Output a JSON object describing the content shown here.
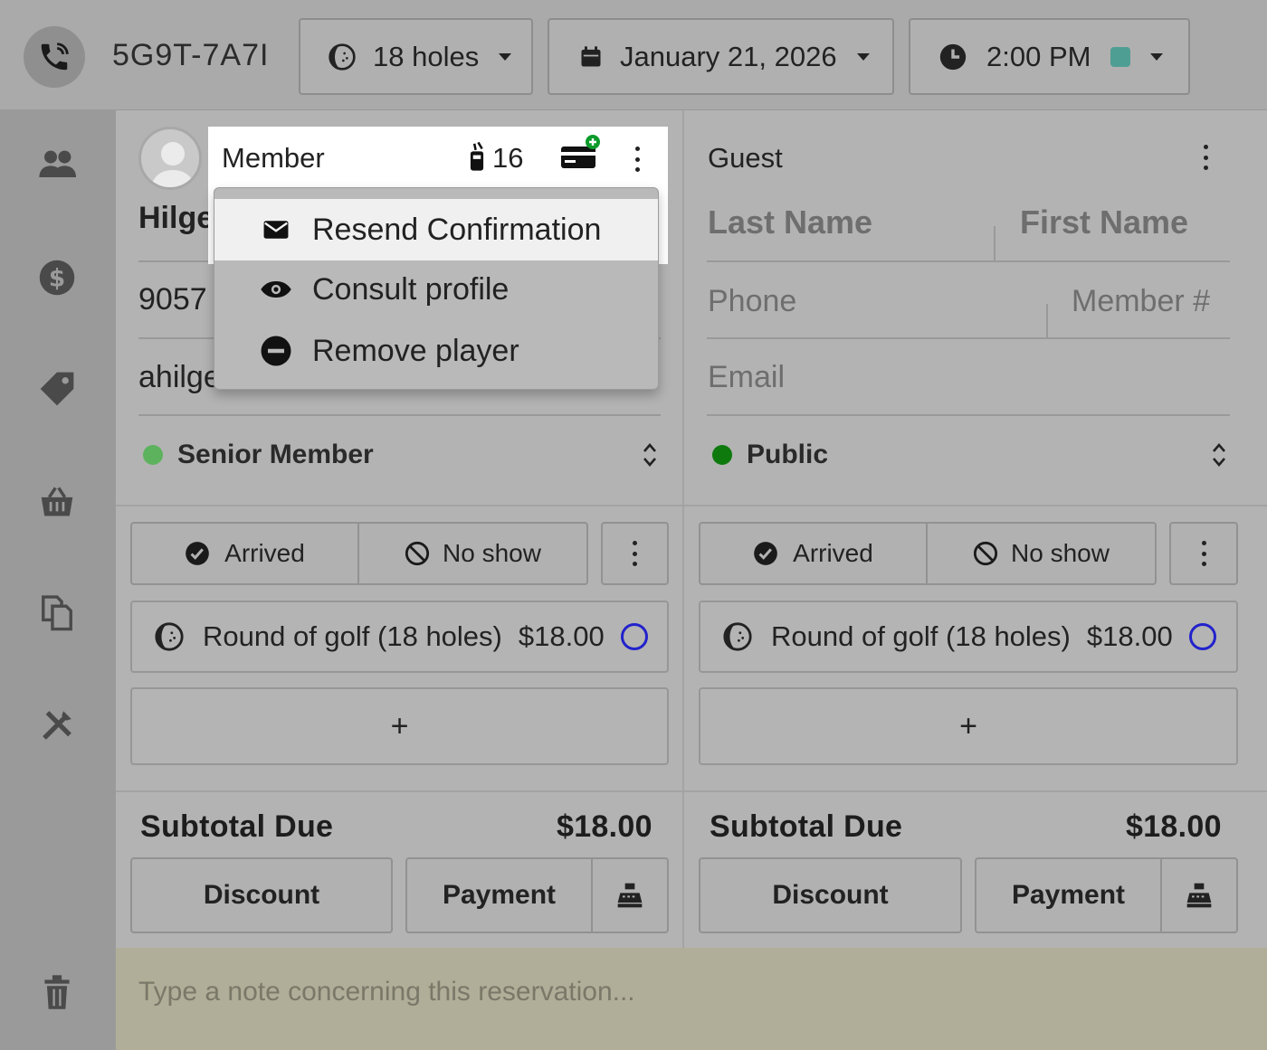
{
  "topbar": {
    "reservation_code": "5G9T-7A7I",
    "holes": "18 holes",
    "date": "January 21, 2026",
    "time": "2:00 PM",
    "time_color": "#4f9e93"
  },
  "sidebar": {
    "icons": [
      "users-icon",
      "dollar-icon",
      "tag-icon",
      "basket-icon",
      "documents-icon",
      "golf-tools-icon",
      "trash-icon"
    ]
  },
  "player1": {
    "type": "Member",
    "bag_count": "16",
    "name_partial": "Hilge",
    "phone_partial": "9057",
    "email_partial": "ahilge",
    "category": "Senior Member",
    "category_color": "#5db35d",
    "arrived": "Arrived",
    "no_show": "No show",
    "service_label": "Round of golf (18 holes)",
    "service_price": "$18.00",
    "add": "+",
    "subtotal_label": "Subtotal Due",
    "subtotal_value": "$18.00",
    "discount": "Discount",
    "payment": "Payment"
  },
  "player2": {
    "type": "Guest",
    "last_name_placeholder": "Last Name",
    "first_name_placeholder": "First Name",
    "phone_placeholder": "Phone",
    "member_placeholder": "Member #",
    "email_placeholder": "Email",
    "category": "Public",
    "category_color": "#0e7a0e",
    "arrived": "Arrived",
    "no_show": "No show",
    "service_label": "Round of golf (18 holes)",
    "service_price": "$18.00",
    "add": "+",
    "subtotal_label": "Subtotal Due",
    "subtotal_value": "$18.00",
    "discount": "Discount",
    "payment": "Payment"
  },
  "menu": {
    "items": [
      "Resend Confirmation",
      "Consult profile",
      "Remove player"
    ]
  },
  "note": {
    "placeholder": "Type a note concerning this reservation..."
  }
}
